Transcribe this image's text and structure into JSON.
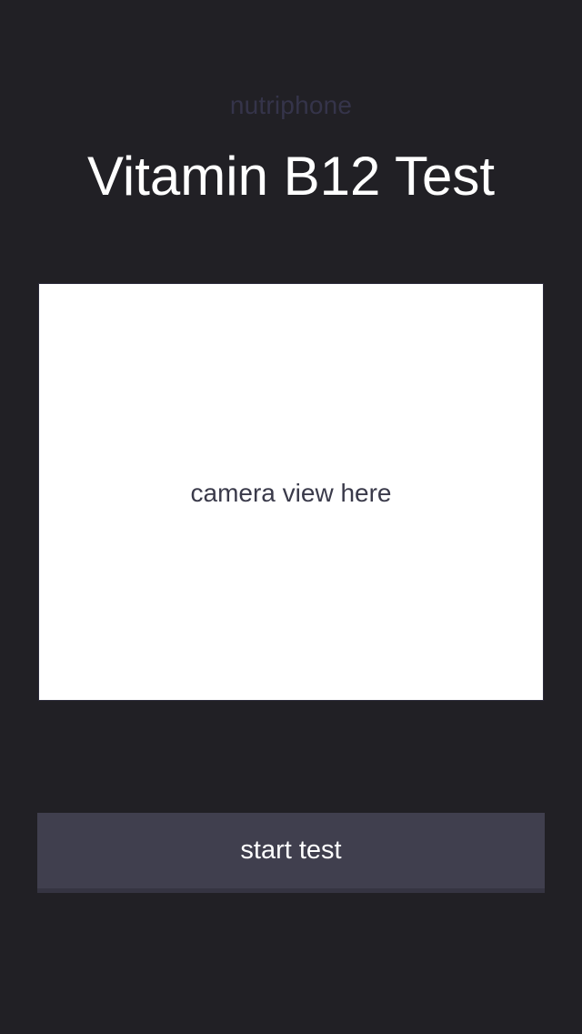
{
  "app": {
    "brand": "nutriphone"
  },
  "header": {
    "title": "Vitamin B12 Test"
  },
  "camera": {
    "placeholder_text": "camera view here"
  },
  "actions": {
    "start_label": "start test"
  },
  "colors": {
    "background": "#212025",
    "brand_text": "#35344a",
    "title_text": "#ffffff",
    "camera_background": "#ffffff",
    "camera_text": "#3a3a4a",
    "button_background": "#403f4e",
    "button_text": "#ffffff"
  }
}
